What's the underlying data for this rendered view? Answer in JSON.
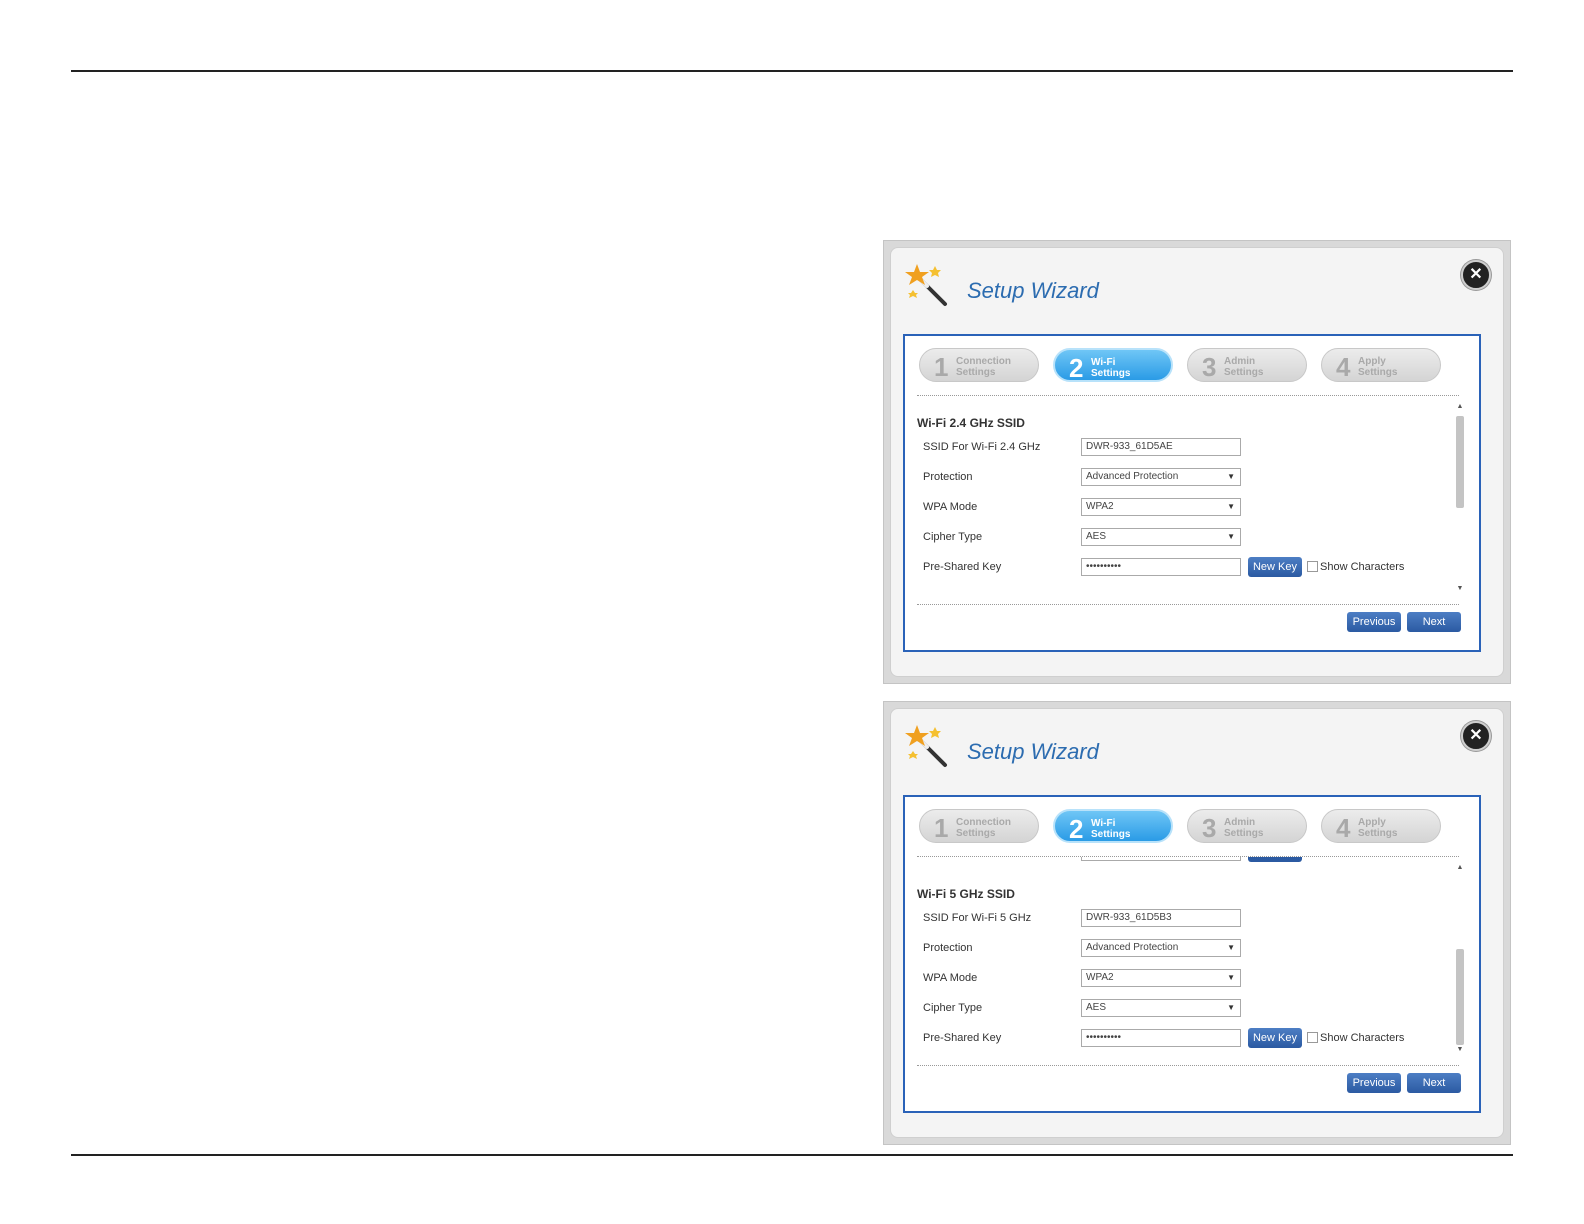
{
  "wizards": [
    {
      "title": "Setup Wizard",
      "close_icon": "close-icon",
      "steps": [
        {
          "num": "1",
          "label": "Connection\nSettings",
          "active": false
        },
        {
          "num": "2",
          "label": "Wi-Fi\nSettings",
          "active": true
        },
        {
          "num": "3",
          "label": "Admin\nSettings",
          "active": false
        },
        {
          "num": "4",
          "label": "Apply\nSettings",
          "active": false
        }
      ],
      "section_title": "Wi-Fi 2.4 GHz SSID",
      "ssid_label": "SSID For Wi-Fi 2.4 GHz",
      "ssid_value": "DWR-933_61D5AE",
      "protection_label": "Protection",
      "protection_value": "Advanced Protection",
      "wpa_label": "WPA Mode",
      "wpa_value": "WPA2",
      "cipher_label": "Cipher Type",
      "cipher_value": "AES",
      "psk_label": "Pre-Shared Key",
      "psk_value": "••••••••••",
      "new_key_label": "New Key",
      "show_chars_label": "Show Characters",
      "previous_label": "Previous",
      "next_label": "Next"
    },
    {
      "title": "Setup Wizard",
      "close_icon": "close-icon",
      "steps": [
        {
          "num": "1",
          "label": "Connection\nSettings",
          "active": false
        },
        {
          "num": "2",
          "label": "Wi-Fi\nSettings",
          "active": true
        },
        {
          "num": "3",
          "label": "Admin\nSettings",
          "active": false
        },
        {
          "num": "4",
          "label": "Apply\nSettings",
          "active": false
        }
      ],
      "section_title": "Wi-Fi 5 GHz SSID",
      "ssid_label": "SSID For Wi-Fi 5 GHz",
      "ssid_value": "DWR-933_61D5B3",
      "protection_label": "Protection",
      "protection_value": "Advanced Protection",
      "wpa_label": "WPA Mode",
      "wpa_value": "WPA2",
      "cipher_label": "Cipher Type",
      "cipher_value": "AES",
      "psk_label": "Pre-Shared Key",
      "psk_value": "••••••••••",
      "new_key_label": "New Key",
      "show_chars_label": "Show Characters",
      "previous_label": "Previous",
      "next_label": "Next"
    }
  ],
  "colors": {
    "accent": "#2c6cb0",
    "active_step": "#2a9be6",
    "button": "#2b5aa2",
    "border": "#2a62b8"
  }
}
